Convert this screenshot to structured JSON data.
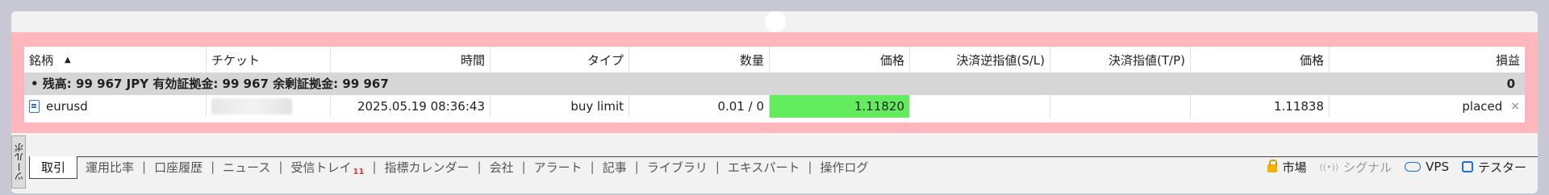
{
  "table": {
    "headers": [
      "銘柄",
      "チケット",
      "時間",
      "タイプ",
      "数量",
      "価格",
      "決済逆指値(S/L)",
      "決済指値(T/P)",
      "価格",
      "損益"
    ],
    "sort_arrow": "▲",
    "summary": {
      "text": "• 残高: 99 967 JPY  有効証拠金: 99 967  余剰証拠金: 99 967",
      "profit": "0"
    },
    "row": {
      "symbol": "eurusd",
      "ticket": "",
      "time": "2025.05.19 08:36:43",
      "type": "buy limit",
      "volume": "0.01 / 0",
      "price": "1.11820",
      "sl": "",
      "tp": "",
      "current_price": "1.11838",
      "status": "placed",
      "close": "×"
    }
  },
  "side_tab": {
    "label": "ツールボ"
  },
  "tabs": [
    {
      "label": "取引",
      "active": true
    },
    {
      "label": "運用比率"
    },
    {
      "label": "口座履歴"
    },
    {
      "label": "ニュース"
    },
    {
      "label": "受信トレイ",
      "badge": "11"
    },
    {
      "label": "指標カレンダー"
    },
    {
      "label": "会社"
    },
    {
      "label": "アラート"
    },
    {
      "label": "記事"
    },
    {
      "label": "ライブラリ"
    },
    {
      "label": "エキスパート"
    },
    {
      "label": "操作ログ"
    }
  ],
  "tools": {
    "market": "市場",
    "signal": "シグナル",
    "vps": "VPS",
    "tester": "テスター"
  },
  "colors": {
    "highlight": "#ffb6bd",
    "price_cell": "#64ec5f"
  }
}
